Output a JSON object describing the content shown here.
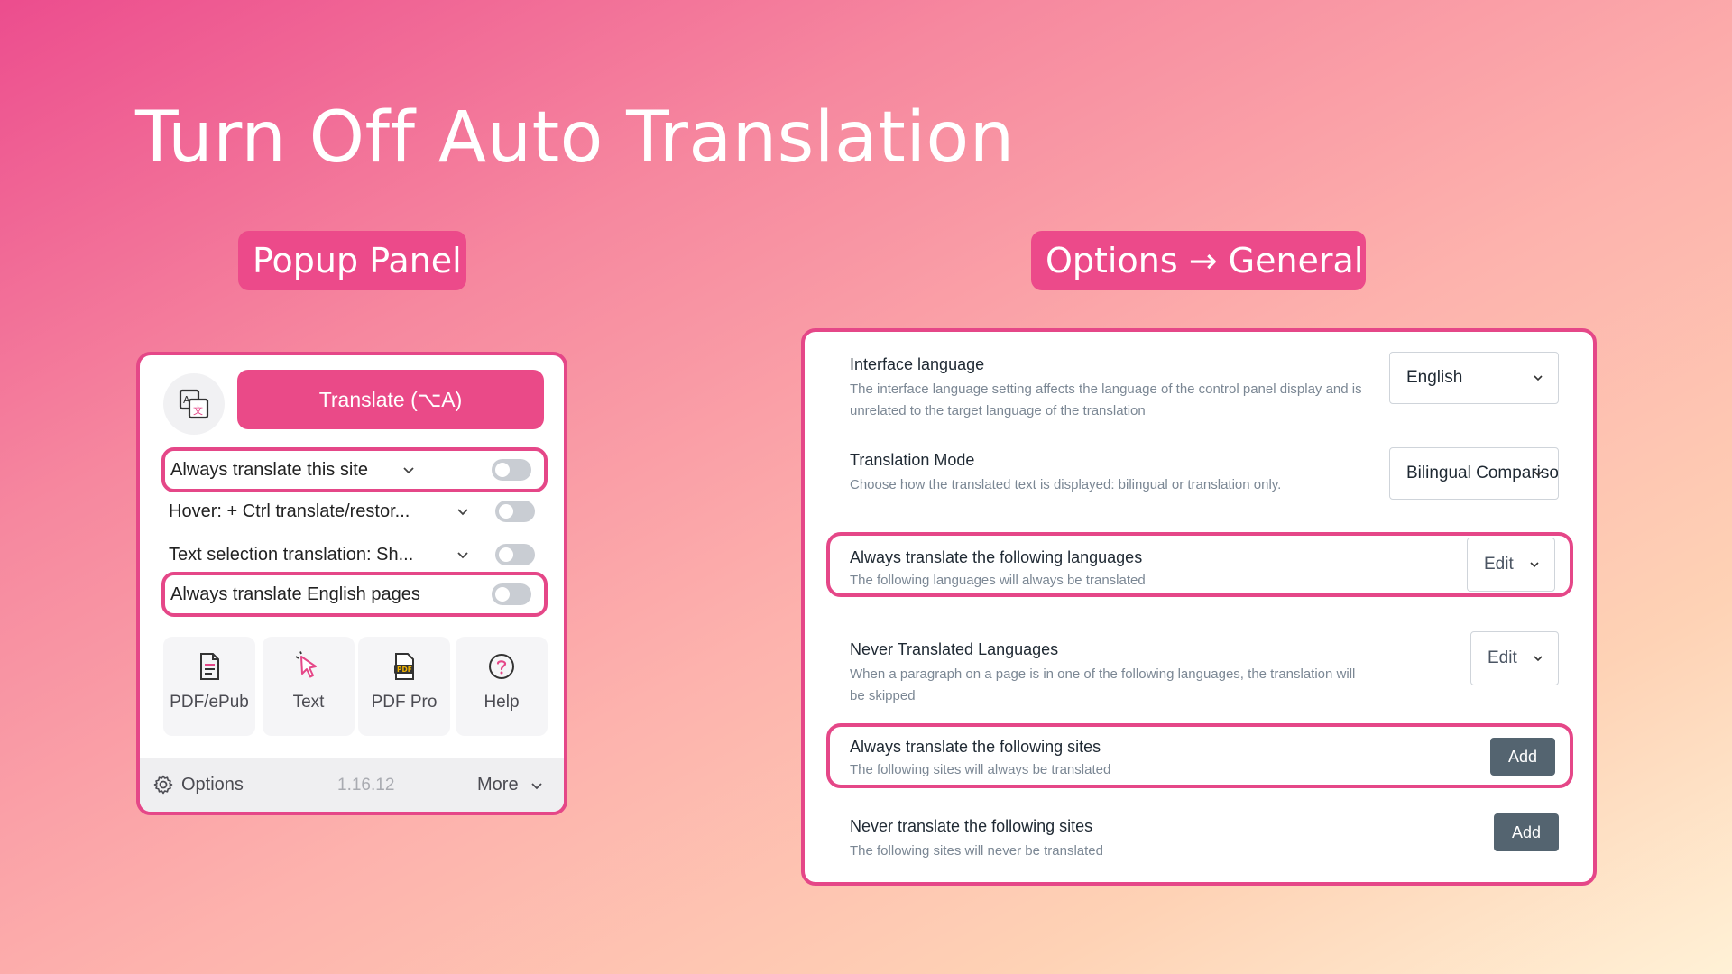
{
  "title": "Turn Off Auto Translation",
  "badges": {
    "left": "Popup Panel",
    "right": "Options → General"
  },
  "popup": {
    "logo_icon": "translate-logo-icon",
    "translate_button": "Translate (⌥A)",
    "rows": [
      {
        "label": "Always translate this site",
        "highlighted": true,
        "enabled": false
      },
      {
        "label": "Hover:  + Ctrl translate/restor...",
        "highlighted": false,
        "enabled": false
      },
      {
        "label": "Text selection translation:  Sh...",
        "highlighted": false,
        "enabled": false
      },
      {
        "label": "Always translate English pages",
        "highlighted": true,
        "enabled": false
      }
    ],
    "tools": [
      {
        "label": "PDF/ePub",
        "icon": "document-icon"
      },
      {
        "label": "Text",
        "icon": "cursor-icon"
      },
      {
        "label": "PDF Pro",
        "icon": "pdf-icon"
      },
      {
        "label": "Help",
        "icon": "help-icon"
      }
    ],
    "footer": {
      "options": "Options",
      "version": "1.16.12",
      "more": "More"
    }
  },
  "options": {
    "settings": [
      {
        "title": "Interface language",
        "desc": "The interface language setting affects the language of the control panel display and is unrelated to the target language of the translation",
        "control": "select",
        "value": "English"
      },
      {
        "title": "Translation Mode",
        "desc": "Choose how the translated text is displayed: bilingual or translation only.",
        "control": "select",
        "value": "Bilingual Comparison"
      },
      {
        "title": "Always translate the following languages",
        "desc": "The following languages will always be translated",
        "control": "edit",
        "value": "Edit",
        "highlighted": true
      },
      {
        "title": "Never Translated Languages",
        "desc": "When a paragraph on a page is in one of the following languages, the translation will be skipped",
        "control": "edit",
        "value": "Edit"
      },
      {
        "title": "Always translate the following sites",
        "desc": "The following sites will always be translated",
        "control": "add",
        "value": "Add",
        "highlighted": true
      },
      {
        "title": "Never translate the following sites",
        "desc": "The following sites will never be translated",
        "control": "add",
        "value": "Add"
      }
    ]
  },
  "colors": {
    "accent": "#ea4a88",
    "toggle_off": "#c9cdd3",
    "add_button": "#546470"
  }
}
